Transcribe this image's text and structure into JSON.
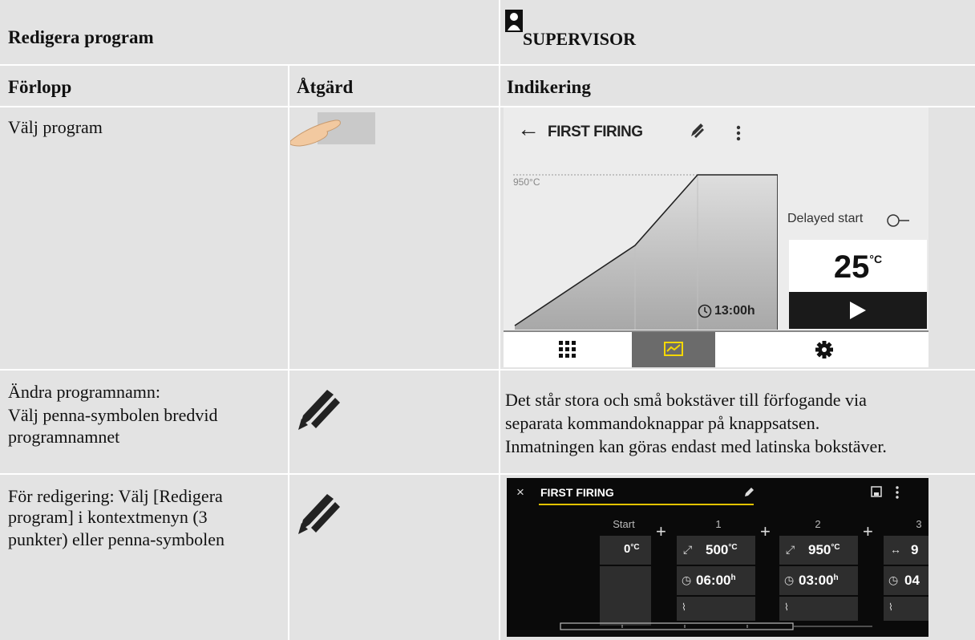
{
  "header": {
    "title": "Redigera program",
    "role": "SUPERVISOR"
  },
  "columns": [
    "Förlopp",
    "Åtgärd",
    "Indikering"
  ],
  "rows": [
    {
      "step": [
        "Välj program"
      ]
    },
    {
      "step": [
        "Ändra programnamn:",
        "Välj penna-symbolen bredvid",
        "programnamnet"
      ],
      "indication": [
        "Det står stora och små bokstäver till förfogande via",
        "separata kommandoknappar på knappsatsen.",
        "Inmatningen kan göras endast med latinska bokstäver."
      ]
    },
    {
      "step": [
        "För redigering: Välj [Redigera",
        "program] i kontextmenyn (3",
        "punkter) eller penna-symbolen"
      ]
    }
  ],
  "screen1": {
    "back": "←",
    "program_name": "FIRST FIRING",
    "max_temp_label": "950°C",
    "time_label": "13:00h",
    "delayed_start": "Delayed start",
    "temp_value": "25",
    "temp_unit": "°C",
    "accent": "#f5d800"
  },
  "screen2": {
    "close": "×",
    "program_name": "FIRST FIRING",
    "labels": [
      "Start",
      "1",
      "2",
      "3"
    ],
    "start_temp": "0",
    "unit_c": "°C",
    "unit_h": "h",
    "seg1_temp": "500",
    "seg1_time": "06:00",
    "seg2_temp": "950",
    "seg2_time": "03:00",
    "seg3_temp": "9",
    "seg3_time": "04",
    "underline": "#e2c200"
  }
}
